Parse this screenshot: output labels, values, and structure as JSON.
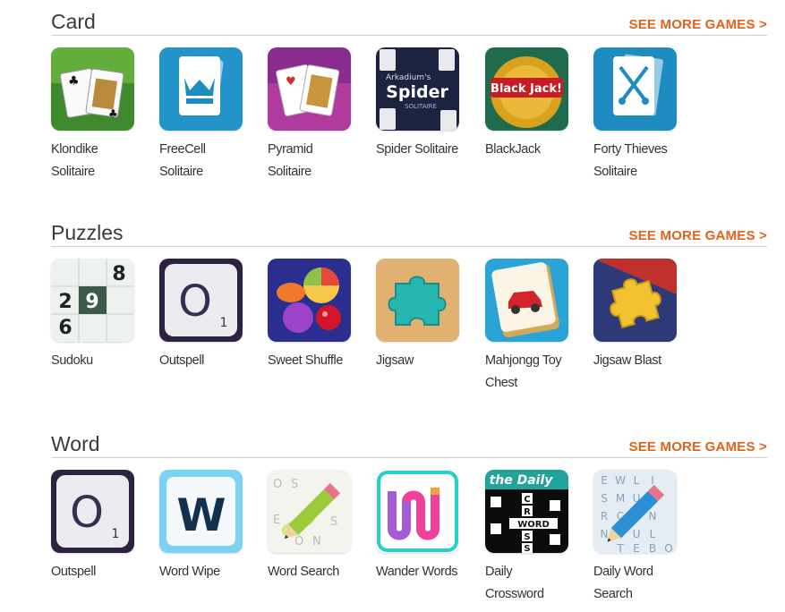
{
  "sections": [
    {
      "title": "Card",
      "see_more": "SEE MORE GAMES >",
      "games": [
        {
          "name_line1": "Klondike",
          "name_line2": "Solitaire",
          "icon": "klondike-cards-icon"
        },
        {
          "name_line1": "FreeCell",
          "name_line2": "Solitaire",
          "icon": "freecell-crown-icon"
        },
        {
          "name_line1": "Pyramid",
          "name_line2": "Solitaire",
          "icon": "pyramid-cards-icon"
        },
        {
          "name_line1": "Spider Solitaire",
          "name_line2": "",
          "icon": "spider-solitaire-icon",
          "thumb_text": "Spider",
          "thumb_top": "Arkadium's",
          "thumb_sub": "SOLITAIRE"
        },
        {
          "name_line1": "BlackJack",
          "name_line2": "",
          "icon": "blackjack-chip-icon",
          "thumb_text": "Black Jack!"
        },
        {
          "name_line1": "Forty Thieves",
          "name_line2": "Solitaire",
          "icon": "crossed-swords-icon"
        }
      ]
    },
    {
      "title": "Puzzles",
      "see_more": "SEE MORE GAMES >",
      "games": [
        {
          "name_line1": "Sudoku",
          "name_line2": "",
          "icon": "sudoku-grid-icon",
          "digits": [
            "8",
            "2",
            "9",
            "6"
          ]
        },
        {
          "name_line1": "Outspell",
          "name_line2": "",
          "icon": "letter-tile-o-icon",
          "tile_letter": "O",
          "tile_score": "1"
        },
        {
          "name_line1": "Sweet Shuffle",
          "name_line2": "",
          "icon": "candy-icon"
        },
        {
          "name_line1": "Jigsaw",
          "name_line2": "",
          "icon": "puzzle-piece-icon"
        },
        {
          "name_line1": "Mahjongg Toy",
          "name_line2": "Chest",
          "icon": "mahjongg-tile-car-icon"
        },
        {
          "name_line1": "Jigsaw Blast",
          "name_line2": "",
          "icon": "puzzle-piece-gold-icon"
        }
      ]
    },
    {
      "title": "Word",
      "see_more": "SEE MORE GAMES >",
      "games": [
        {
          "name_line1": "Outspell",
          "name_line2": "",
          "icon": "letter-tile-o-icon",
          "tile_letter": "O",
          "tile_score": "1"
        },
        {
          "name_line1": "Word Wipe",
          "name_line2": "",
          "icon": "letter-w-icon",
          "tile_letter": "W"
        },
        {
          "name_line1": "Word Search",
          "name_line2": "",
          "icon": "pencil-word-search-icon"
        },
        {
          "name_line1": "Wander Words",
          "name_line2": "",
          "icon": "wander-w-icon"
        },
        {
          "name_line1": "Daily",
          "name_line2": "Crossword",
          "icon": "daily-crossword-icon",
          "thumb_text": "the Daily",
          "cross_down": [
            "C",
            "R",
            "S",
            "S"
          ],
          "cross_across": "WORD"
        },
        {
          "name_line1": "Daily Word",
          "name_line2": "Search",
          "icon": "daily-word-search-icon",
          "grid_letters": [
            "E",
            "W",
            "L",
            "I",
            "S",
            "M",
            "U",
            "A",
            "R",
            "C",
            "I",
            "N",
            "N",
            "O",
            "U",
            "L",
            "T",
            "E",
            "B",
            "O"
          ]
        }
      ]
    }
  ],
  "colors": {
    "accent": "#e2621b",
    "divider": "#cfcfcf"
  }
}
